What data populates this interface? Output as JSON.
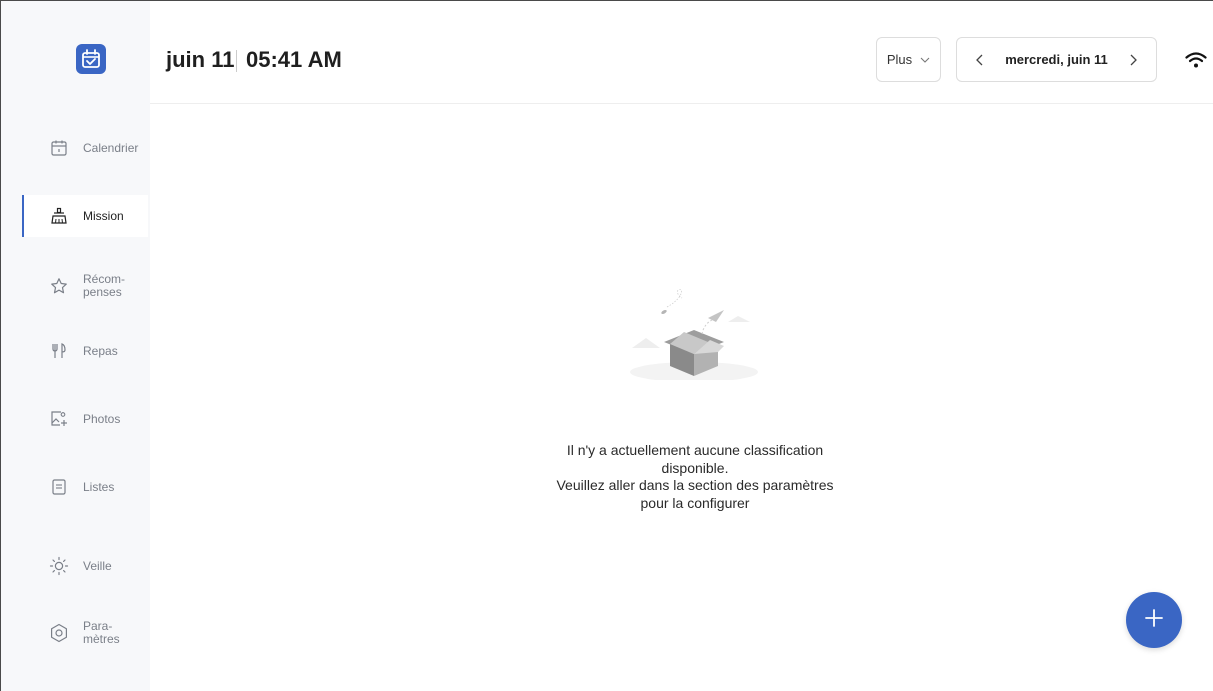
{
  "header": {
    "date": "juin 11",
    "time": "05:41 AM",
    "more_label": "Plus",
    "current_day": "mercredi, juin 11"
  },
  "sidebar": {
    "items": [
      {
        "label": "Calendrier",
        "icon": "calendar-icon"
      },
      {
        "label": "Mission",
        "icon": "broom-icon",
        "active": true
      },
      {
        "label": "Récom-\npenses",
        "icon": "star-icon"
      },
      {
        "label": "Repas",
        "icon": "utensils-icon"
      },
      {
        "label": "Photos",
        "icon": "photo-add-icon"
      },
      {
        "label": "Listes",
        "icon": "list-icon"
      },
      {
        "label": "Veille",
        "icon": "sun-icon"
      },
      {
        "label": "Para-\nmètres",
        "icon": "settings-icon"
      }
    ]
  },
  "main": {
    "empty_line1": "Il n'y a actuellement aucune classification",
    "empty_line2": "disponible.",
    "empty_line3": "Veuillez aller dans la section des paramètres",
    "empty_line4": "pour la configurer"
  },
  "colors": {
    "accent": "#3a66c4",
    "sidebar_bg": "#f7f8fa",
    "muted_text": "#7a7f88"
  }
}
